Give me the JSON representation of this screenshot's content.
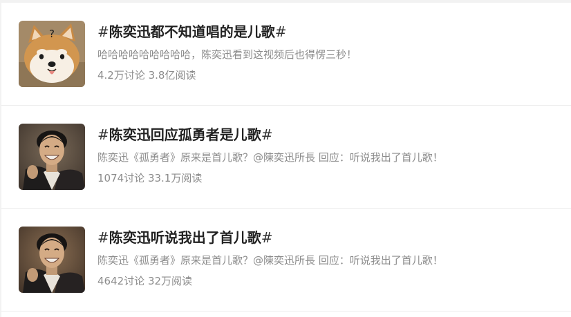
{
  "topics": [
    {
      "hash_open": "#",
      "title": "陈奕迅都不知道唱的是儿歌",
      "hash_close": "#",
      "description": "哈哈哈哈哈哈哈哈哈，陈奕迅看到这视频后也得愣三秒！",
      "stats": "4.2万讨论 3.8亿阅读",
      "thumbnail": "shiba-dog-question-icon",
      "thumbnail_text": "?"
    },
    {
      "hash_open": "#",
      "title": "陈奕迅回应孤勇者是儿歌",
      "hash_close": "#",
      "description": "陈奕迅《孤勇者》原来是首儿歌？@陳奕迅所長 回应：听说我出了首儿歌！",
      "stats": "1074讨论 33.1万阅读",
      "thumbnail": "man-portrait-photo"
    },
    {
      "hash_open": "#",
      "title": "陈奕迅听说我出了首儿歌",
      "hash_close": "#",
      "description": "陈奕迅《孤勇者》原来是首儿歌？@陳奕迅所長 回应：听说我出了首儿歌！",
      "stats": "4642讨论 32万阅读",
      "thumbnail": "man-portrait-photo"
    }
  ],
  "colors": {
    "title": "#222222",
    "meta_text": "#8c8c8c",
    "divider": "#ececec",
    "page_bg": "#f2f2f2"
  }
}
